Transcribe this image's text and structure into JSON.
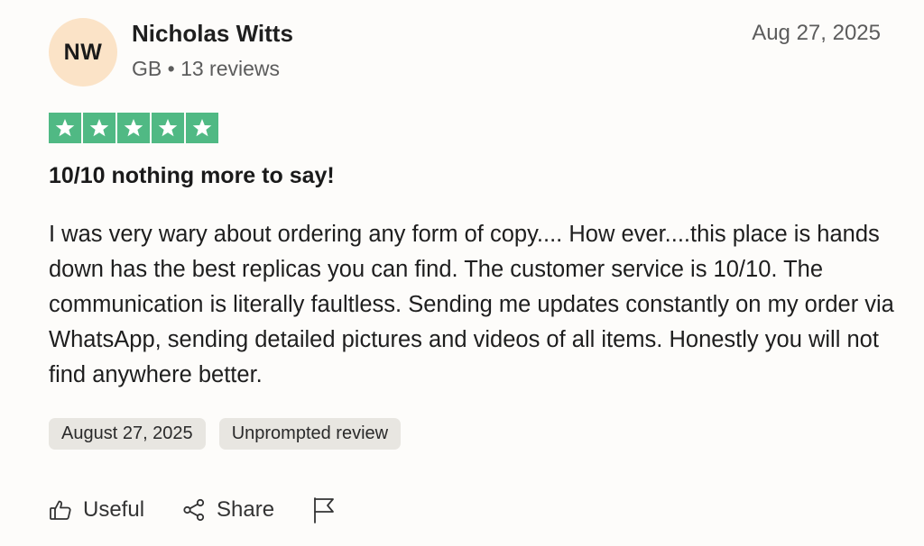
{
  "reviewer": {
    "initials": "NW",
    "name": "Nicholas Witts",
    "meta": "GB • 13 reviews"
  },
  "review": {
    "date": "Aug 27, 2025",
    "rating": 5,
    "rating_max": 5,
    "title": "10/10 nothing more to say!",
    "body": "I was very wary about ordering any form of copy.... How ever....this place is hands down has the best replicas you can find. The customer service is 10/10. The communication is literally faultless. Sending me updates constantly on my order via WhatsApp, sending detailed pictures and videos of all items. Honestly you will not find anywhere better."
  },
  "tags": [
    "August 27, 2025",
    "Unprompted review"
  ],
  "actions": {
    "useful_label": "Useful",
    "share_label": "Share"
  },
  "icons": {
    "useful": "thumbs-up-icon",
    "share": "share-icon",
    "report": "flag-icon",
    "star": "star-icon"
  },
  "colors": {
    "star_fill": "#50b984",
    "avatar_bg": "#fbe3c7",
    "tag_bg": "#e8e6e1"
  }
}
